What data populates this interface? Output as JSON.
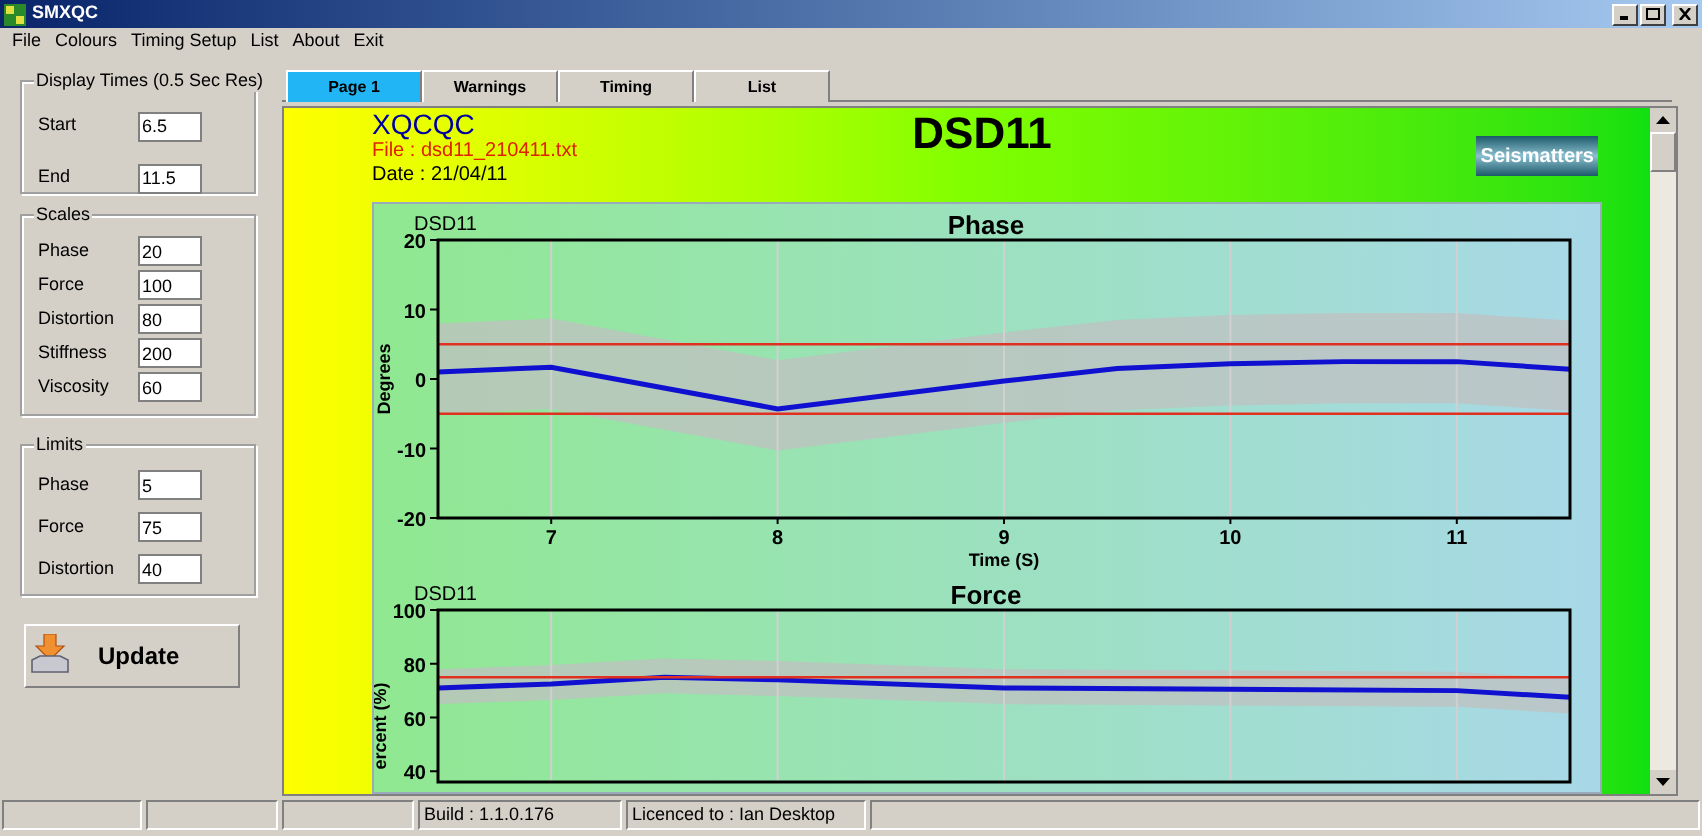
{
  "window": {
    "title": "SMXQC"
  },
  "menu": [
    "File",
    "Colours",
    "Timing Setup",
    "List",
    "About",
    "Exit"
  ],
  "display_times": {
    "title": "Display Times (0.5 Sec Res)",
    "fields": [
      {
        "label": "Start",
        "value": "6.5"
      },
      {
        "label": "End",
        "value": "11.5"
      }
    ]
  },
  "scales": {
    "title": "Scales",
    "fields": [
      {
        "label": "Phase",
        "value": "20"
      },
      {
        "label": "Force",
        "value": "100"
      },
      {
        "label": "Distortion",
        "value": "80"
      },
      {
        "label": "Stiffness",
        "value": "200"
      },
      {
        "label": "Viscosity",
        "value": "60"
      }
    ]
  },
  "limits": {
    "title": "Limits",
    "fields": [
      {
        "label": "Phase",
        "value": "5"
      },
      {
        "label": "Force",
        "value": "75"
      },
      {
        "label": "Distortion",
        "value": "40"
      }
    ]
  },
  "update_button": "Update",
  "tabs": [
    {
      "label": "Page 1",
      "selected": true
    },
    {
      "label": "Warnings",
      "selected": false
    },
    {
      "label": "Timing",
      "selected": false
    },
    {
      "label": "List",
      "selected": false
    }
  ],
  "report": {
    "name": "XQCQC",
    "file": "File : dsd11_210411.txt",
    "date": "Date : 21/04/11",
    "heading": "DSD11",
    "logo": "Seismatters"
  },
  "charts": [
    {
      "caption": "DSD11",
      "chart_data": {
        "type": "line",
        "title": "Phase",
        "xlabel": "Time (S)",
        "ylabel": "Degrees",
        "x": [
          6.5,
          7,
          8,
          9,
          9.5,
          10,
          10.5,
          11,
          11.5
        ],
        "series": [
          {
            "color": "#1010d0",
            "values": [
              1,
              1.7,
              -4.3,
              -0.3,
              1.5,
              2.2,
              2.5,
              2.5,
              1.4
            ]
          },
          {
            "color": "#e03020",
            "values": [
              5,
              5,
              5,
              5,
              5,
              5,
              5,
              5,
              5
            ]
          },
          {
            "color": "#e03020",
            "values": [
              -5,
              -5,
              -5,
              -5,
              -5,
              -5,
              -5,
              -5,
              -5
            ]
          }
        ],
        "grid": true,
        "xlim": [
          6.5,
          11.5
        ],
        "ylim": [
          -20,
          20
        ],
        "xticks": [
          7,
          8,
          9,
          10,
          11
        ],
        "yticks": [
          -20,
          -10,
          0,
          10,
          20
        ]
      }
    },
    {
      "caption": "DSD11",
      "chart_data": {
        "type": "line",
        "title": "Force",
        "ylabel": "ercent (%)",
        "x": [
          6.5,
          7,
          7.5,
          8,
          9,
          10,
          11,
          11.5
        ],
        "series": [
          {
            "color": "#1010d0",
            "values": [
              71,
              72.5,
              75,
              74,
              71,
              70.5,
              70,
              67.5
            ]
          },
          {
            "color": "#e03020",
            "values": [
              75,
              75,
              75,
              75,
              75,
              75,
              75,
              75
            ]
          }
        ],
        "grid": true,
        "xlim": [
          6.5,
          11.5
        ],
        "ylim": [
          36,
          100
        ],
        "yticks": [
          40,
          60,
          80,
          100
        ]
      }
    }
  ],
  "status_bar": [
    "Build : 1.1.0.176",
    "Licenced to : Ian Desktop"
  ]
}
